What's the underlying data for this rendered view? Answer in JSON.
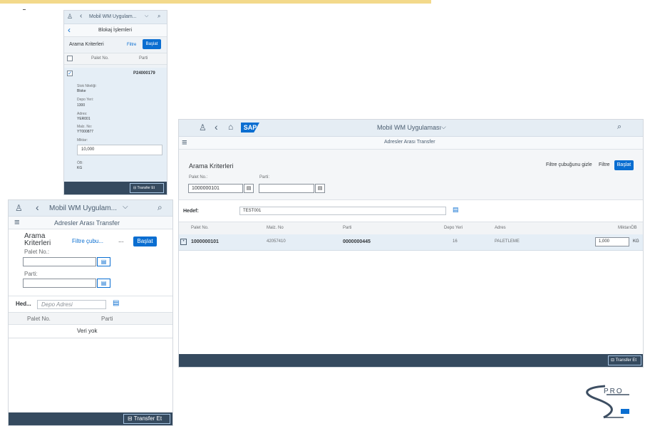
{
  "phone1": {
    "shell_title": "Mobil WM Uygulam...",
    "page_title": "Blokaj İşlemleri",
    "section_title": "Arama Kriterleri",
    "filter_label": "Filtre",
    "start_label": "Başlat",
    "col_palet": "Palet No.",
    "col_parti": "Parti",
    "row_palet": "P24000179",
    "details": [
      {
        "label": "Stok Niteliği:",
        "value": "Bloke"
      },
      {
        "label": "Depo Yeri:",
        "value": "1300"
      },
      {
        "label": "Adres:",
        "value": "YER001"
      },
      {
        "label": "Malz. No:",
        "value": "YT000877"
      }
    ],
    "qty_label": "Miktar:",
    "qty_value": "10,000",
    "uom_label": "ÖB:",
    "uom_value": "KG",
    "transfer_label": "Transfer Et"
  },
  "phone2": {
    "shell_title": "Mobil WM Uygulam...",
    "page_title": "Adresler Arası Transfer",
    "section_title": "Arama Kriterleri",
    "filter_bar_label": "Filtre çubu...",
    "more_label": "...",
    "start_label": "Başlat",
    "palet_label": "Palet No.:",
    "parti_label": "Parti:",
    "target_label": "Hed...",
    "target_placeholder": "Depo Adresi",
    "col_palet": "Palet No.",
    "col_parti": "Parti",
    "no_data": "Veri yok",
    "transfer_label": "Transfer Et"
  },
  "desktop": {
    "logo": "SAP",
    "shell_title": "Mobil WM Uygulaması",
    "page_title": "Adresler Arası Transfer",
    "section_title": "Arama Kriterleri",
    "hide_filter_label": "Filtre çubuğunu gizle",
    "filter_label": "Filtre",
    "start_label": "Başlat",
    "palet_label": "Palet No.:",
    "palet_value": "1000000101",
    "parti_label": "Parti:",
    "target_label": "Hedef:",
    "target_value": "TEST001",
    "columns": [
      "Palet No.",
      "Malz. No",
      "Parti",
      "Depo Yeri",
      "Adres",
      "MiktarıÖB"
    ],
    "row": {
      "palet": "1000000101",
      "malz": "42057410",
      "parti": "0000000445",
      "depo": "16",
      "adres": "PALETLEME",
      "qty": "1,000",
      "uom": "KG"
    },
    "transfer_label": "Transfer Et"
  },
  "logo_text": "PRO"
}
